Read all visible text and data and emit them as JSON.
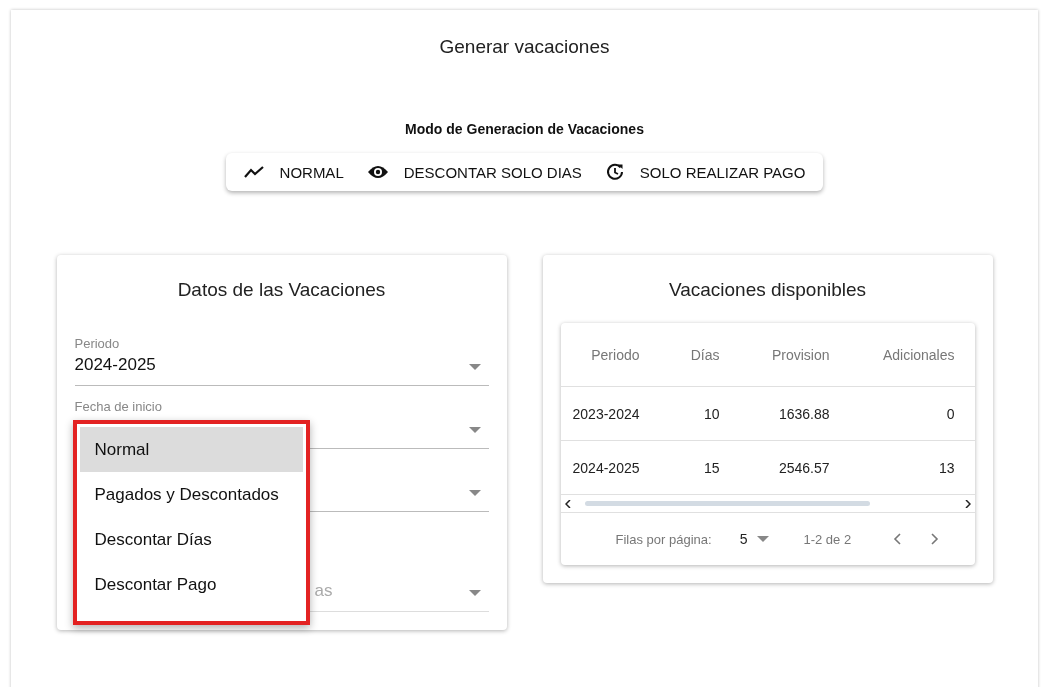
{
  "page": {
    "title": "Generar vacaciones"
  },
  "mode_toggle": {
    "label": "Modo de Generacion de Vacaciones",
    "options": [
      {
        "label": "NORMAL",
        "kind": "trend",
        "selected": false
      },
      {
        "label": "DESCONTAR SOLO DIAS",
        "kind": "eye",
        "selected": false
      },
      {
        "label": "SOLO REALIZAR PAGO",
        "kind": "history",
        "selected": false
      }
    ]
  },
  "details_card": {
    "title": "Datos de las Vacaciones",
    "fields": [
      {
        "label": "Periodo",
        "value": "2024-2025",
        "disabled": false
      },
      {
        "label": "Fecha de inicio",
        "disabled": false
      },
      {
        "disabled": false
      },
      {
        "value": "as",
        "disabled": true
      }
    ],
    "open_menu": {
      "items": [
        {
          "label": "Normal",
          "selected": true
        },
        {
          "label": "Pagados y Descontados",
          "selected": false
        },
        {
          "label": "Descontar Días",
          "selected": false
        },
        {
          "label": "Descontar Pago",
          "selected": false
        }
      ]
    }
  },
  "available_card": {
    "title": "Vacaciones disponibles",
    "table": {
      "columns": [
        "Periodo",
        "Días",
        "Provision",
        "Adicionales"
      ],
      "rows": [
        [
          "2023-2024",
          "10",
          "1636.88",
          "0"
        ],
        [
          "2024-2025",
          "15",
          "2546.57",
          "13"
        ]
      ]
    },
    "pagination": {
      "rows_label": "Filas por página:",
      "rows_value": "5",
      "range": "1-2 de 2"
    }
  }
}
